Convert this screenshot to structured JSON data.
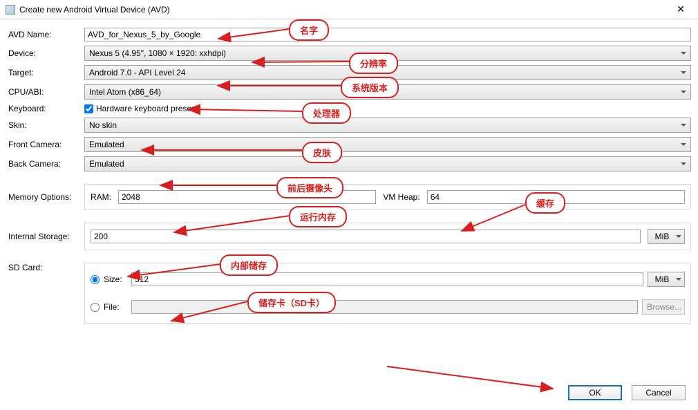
{
  "window": {
    "title": "Create new Android Virtual Device (AVD)"
  },
  "labels": {
    "avd_name": "AVD Name:",
    "device": "Device:",
    "target": "Target:",
    "cpu_abi": "CPU/ABI:",
    "keyboard": "Keyboard:",
    "skin": "Skin:",
    "front_camera": "Front Camera:",
    "back_camera": "Back Camera:",
    "memory_options": "Memory Options:",
    "internal_storage": "Internal Storage:",
    "sd_card": "SD Card:",
    "ram": "RAM:",
    "vm_heap": "VM Heap:",
    "size": "Size:",
    "file": "File:",
    "hw_keyboard": "Hardware keyboard present",
    "browse": "Browse...",
    "ok": "OK",
    "cancel": "Cancel",
    "mib": "MiB"
  },
  "values": {
    "avd_name": "AVD_for_Nexus_5_by_Google",
    "device": "Nexus 5 (4.95\", 1080 × 1920: xxhdpi)",
    "target": "Android 7.0 - API Level 24",
    "cpu_abi": "Intel Atom (x86_64)",
    "hw_keyboard_checked": true,
    "skin": "No skin",
    "front_camera": "Emulated",
    "back_camera": "Emulated",
    "ram": "2048",
    "vm_heap": "64",
    "internal_storage": "200",
    "internal_storage_unit": "MiB",
    "sd_size": "512",
    "sd_size_unit": "MiB",
    "sd_file": "",
    "sd_mode": "size"
  },
  "callouts": {
    "name": "名字",
    "resolution": "分辨率",
    "system_version": "系统版本",
    "cpu": "处理器",
    "skin": "皮肤",
    "camera": "前后摄像头",
    "ram": "运行内存",
    "heap": "缓存",
    "internal": "内部储存",
    "sdcard": "储存卡（SD卡）"
  }
}
